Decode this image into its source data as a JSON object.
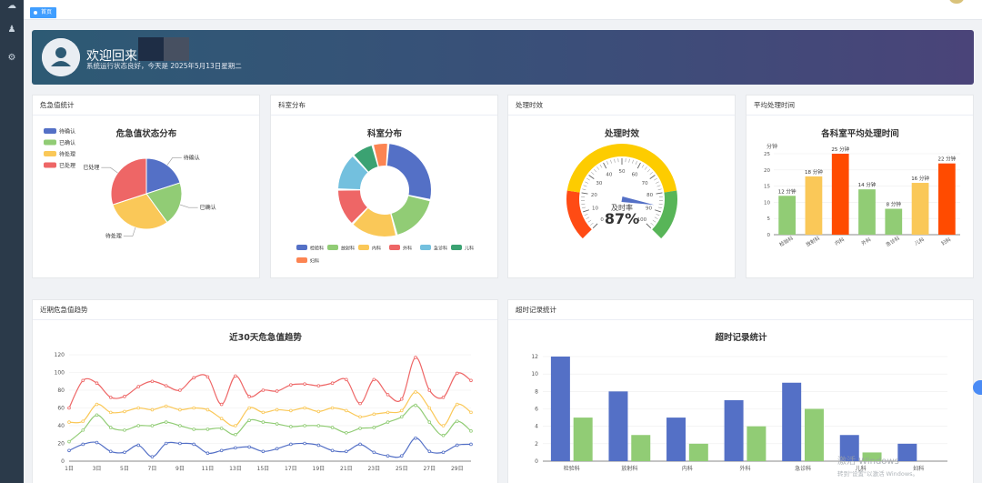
{
  "tab": {
    "label": "首页"
  },
  "welcome": {
    "title": "欢迎回来，",
    "subtitle": "系统运行状态良好，今天是 2025年5月13日星期二"
  },
  "cards": {
    "critical_status": "危急值统计",
    "department": "科室分布",
    "timeliness": "处理时效",
    "avg_time": "平均处理时间",
    "trend": "近期危急值趋势",
    "overtime": "超时记录统计"
  },
  "colors": {
    "blue": "#5470c6",
    "green": "#91cc75",
    "yellow": "#fac858",
    "red": "#ee6666",
    "cyan": "#73c0de",
    "teal": "#3ba272",
    "orange": "#fc8452"
  },
  "charts": {
    "status_pie": {
      "type": "pie",
      "title": "危急值状态分布",
      "labels": [
        "待确认",
        "已确认",
        "待处理",
        "已处理"
      ],
      "values": [
        20,
        20,
        30,
        30
      ]
    },
    "dept_donut": {
      "type": "pie",
      "title": "科室分布",
      "labels": [
        "检验科",
        "放射科",
        "内科",
        "外科",
        "急诊科",
        "儿科",
        "妇科"
      ],
      "values": [
        25,
        16,
        15,
        12,
        12,
        7,
        5
      ]
    },
    "gauge": {
      "type": "gauge",
      "title": "处理时效",
      "label": "及时率",
      "value": 87,
      "value_text": "87%",
      "ticks": [
        "0",
        "10",
        "20",
        "30",
        "40",
        "50",
        "60",
        "70",
        "80",
        "90",
        "100"
      ]
    },
    "avg_bar": {
      "type": "bar",
      "title": "各科室平均处理时间",
      "unit_label": "分钟",
      "categories": [
        "检验科",
        "放射科",
        "内科",
        "外科",
        "急诊科",
        "儿科",
        "妇科"
      ],
      "values": [
        12,
        18,
        25,
        14,
        8,
        16,
        22
      ],
      "value_labels": [
        "12 分钟",
        "18 分钟",
        "25 分钟",
        "14 分钟",
        "8 分钟",
        "16 分钟",
        "22 分钟"
      ],
      "yticks": [
        "0",
        "5",
        "10",
        "15",
        "20",
        "25"
      ],
      "ylim": [
        0,
        25
      ]
    },
    "trend_line": {
      "type": "line",
      "title": "近30天危急值趋势",
      "x": [
        "1日",
        "2日",
        "3日",
        "4日",
        "5日",
        "6日",
        "7日",
        "8日",
        "9日",
        "10日",
        "11日",
        "12日",
        "13日",
        "14日",
        "15日",
        "16日",
        "17日",
        "18日",
        "19日",
        "20日",
        "21日",
        "22日",
        "23日",
        "24日",
        "25日",
        "26日",
        "27日",
        "28日",
        "29日",
        "30日"
      ],
      "xticks": [
        "1日",
        "3日",
        "5日",
        "7日",
        "9日",
        "11日",
        "13日",
        "15日",
        "17日",
        "19日",
        "21日",
        "23日",
        "25日",
        "27日",
        "29日"
      ],
      "yticks": [
        "0",
        "20",
        "40",
        "60",
        "80",
        "100",
        "120"
      ],
      "ylim": [
        0,
        120
      ],
      "series": [
        {
          "color": "#5470c6",
          "values": [
            12,
            19,
            21,
            11,
            10,
            18,
            5,
            20,
            20,
            19,
            9,
            12,
            15,
            16,
            11,
            14,
            19,
            20,
            18,
            12,
            11,
            19,
            10,
            6,
            6,
            26,
            11,
            10,
            18,
            19
          ]
        },
        {
          "color": "#91cc75",
          "values": [
            22,
            35,
            52,
            38,
            35,
            40,
            40,
            44,
            40,
            36,
            36,
            37,
            30,
            46,
            44,
            42,
            39,
            40,
            40,
            38,
            32,
            37,
            38,
            44,
            50,
            63,
            44,
            29,
            45,
            34
          ]
        },
        {
          "color": "#fac858",
          "values": [
            44,
            45,
            64,
            55,
            56,
            60,
            58,
            62,
            58,
            60,
            58,
            48,
            40,
            60,
            55,
            58,
            57,
            60,
            56,
            60,
            57,
            50,
            53,
            55,
            57,
            78,
            60,
            40,
            64,
            55
          ]
        },
        {
          "color": "#ee6666",
          "values": [
            60,
            91,
            88,
            72,
            73,
            84,
            90,
            85,
            80,
            94,
            95,
            64,
            96,
            73,
            80,
            79,
            86,
            87,
            85,
            88,
            92,
            65,
            92,
            75,
            70,
            117,
            80,
            72,
            99,
            91
          ]
        }
      ]
    },
    "overtime_bar": {
      "type": "bar",
      "title": "超时记录统计",
      "categories": [
        "检验科",
        "放射科",
        "内科",
        "外科",
        "急诊科",
        "儿科",
        "妇科"
      ],
      "series": [
        {
          "color": "#5470c6",
          "values": [
            12,
            8,
            5,
            7,
            9,
            3,
            2
          ]
        },
        {
          "color": "#91cc75",
          "values": [
            5,
            3,
            2,
            4,
            6,
            1,
            0
          ]
        }
      ],
      "yticks": [
        "0",
        "2",
        "4",
        "6",
        "8",
        "10",
        "12"
      ],
      "ylim": [
        0,
        12
      ]
    }
  },
  "watermark": {
    "line1": "激活 Windows",
    "line2": "转到\"设置\"以激活 Windows。"
  }
}
